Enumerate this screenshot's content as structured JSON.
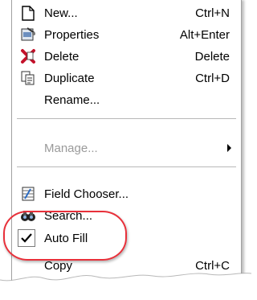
{
  "menu": {
    "items": [
      {
        "label": "New...",
        "shortcut": "Ctrl+N",
        "icon": "new-document-icon"
      },
      {
        "label": "Properties",
        "shortcut": "Alt+Enter",
        "icon": "properties-icon"
      },
      {
        "label": "Delete",
        "shortcut": "Delete",
        "icon": "delete-x-icon"
      },
      {
        "label": "Duplicate",
        "shortcut": "Ctrl+D",
        "icon": "duplicate-icon"
      },
      {
        "label": "Rename...",
        "shortcut": ""
      },
      {
        "label": "Manage...",
        "state": "disabled",
        "submenu": true
      },
      {
        "label": "Field Chooser...",
        "icon": "field-chooser-icon"
      },
      {
        "label": "Search...",
        "icon": "binoculars-icon"
      },
      {
        "label": "Auto Fill",
        "checked": true,
        "icon": "check-icon"
      },
      {
        "label": "Copy",
        "shortcut": "Ctrl+C"
      }
    ]
  },
  "colors": {
    "highlight_oval": "#e8303a",
    "disabled_text": "#9a9a9a"
  }
}
